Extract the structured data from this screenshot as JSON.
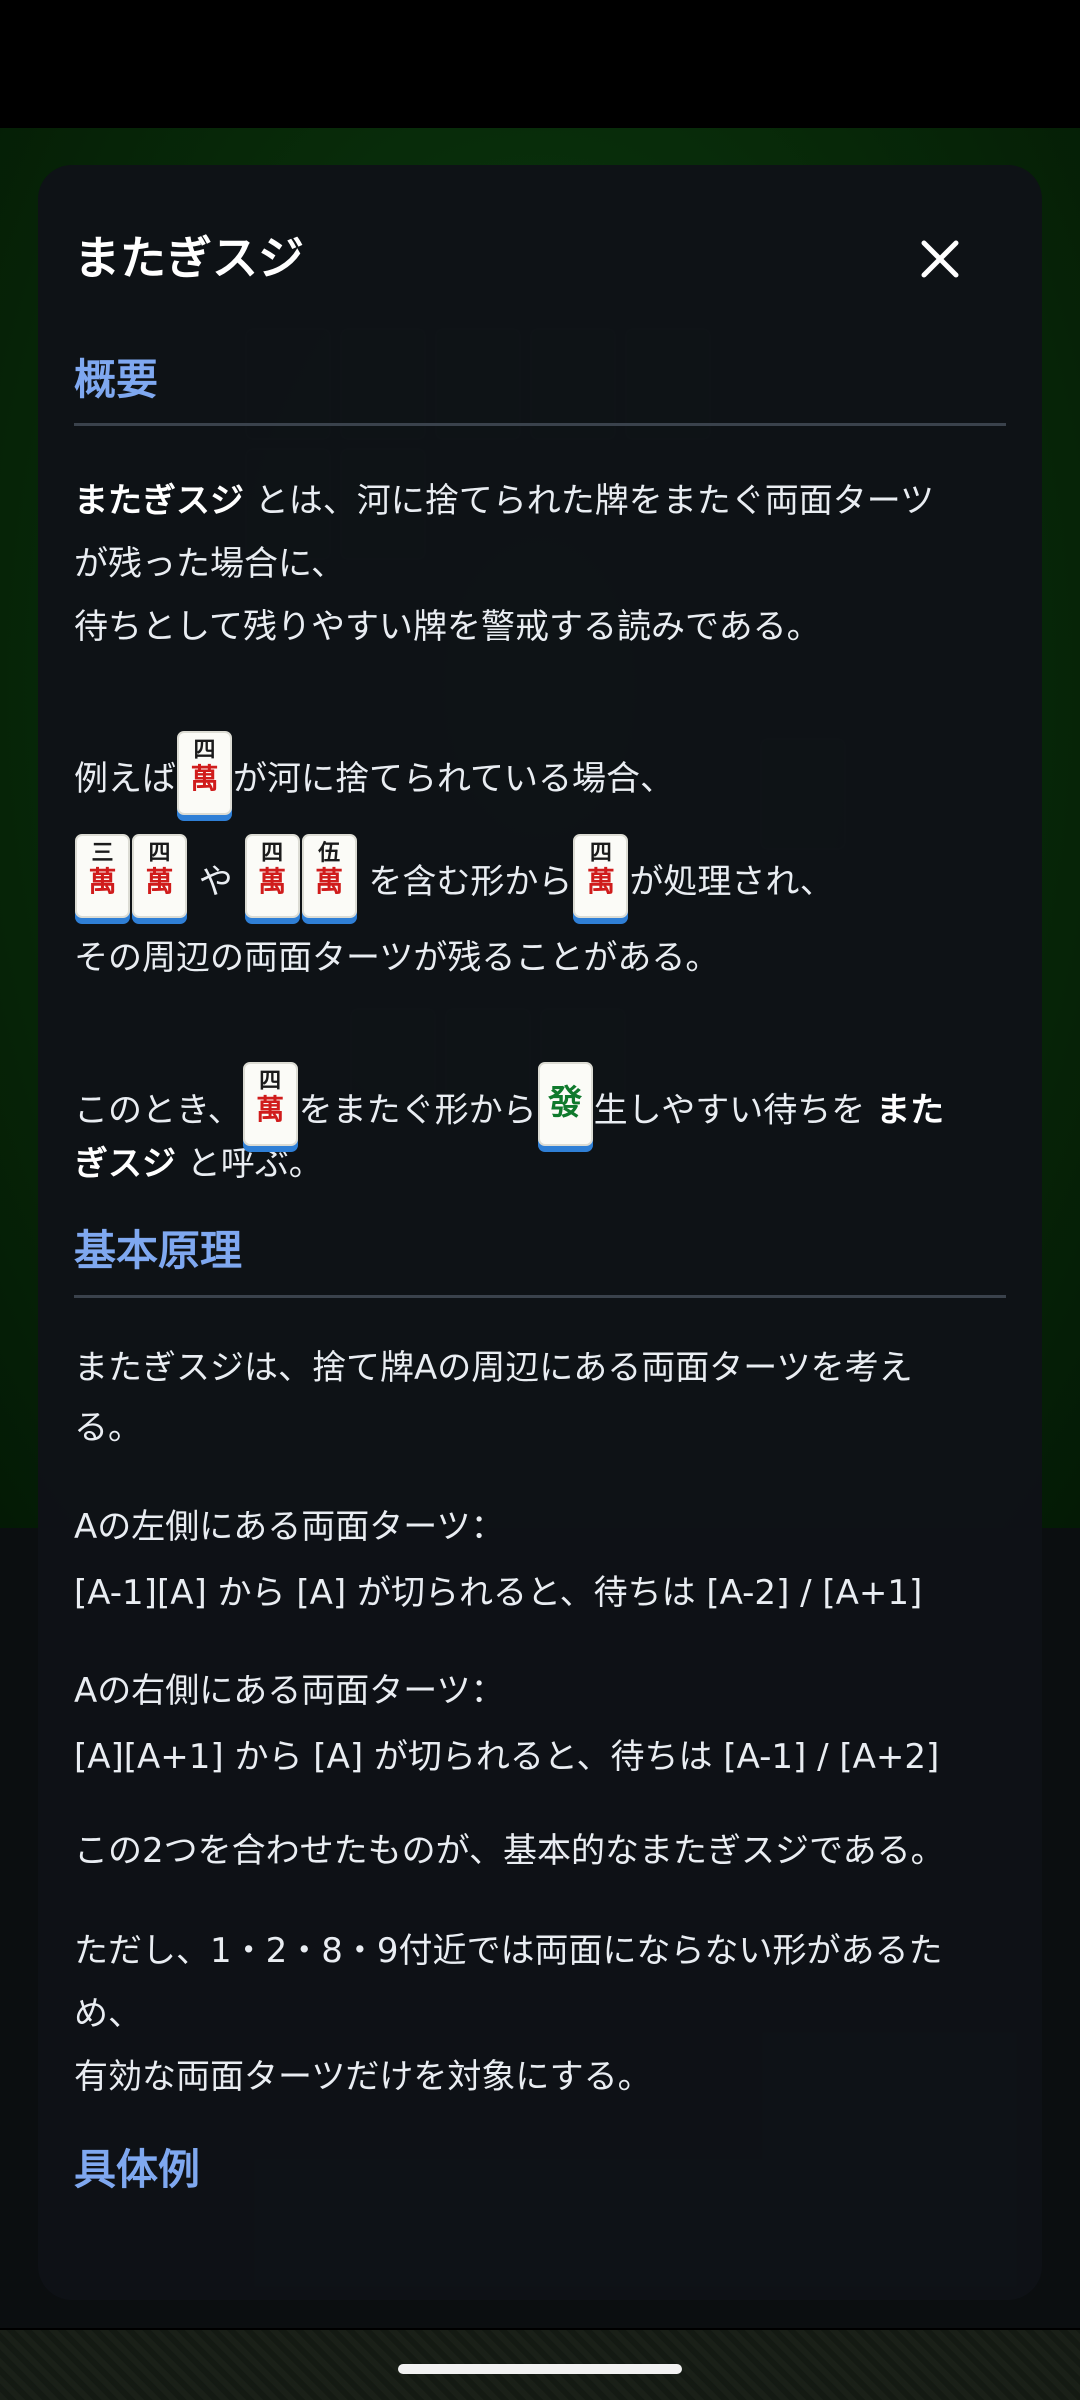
{
  "modal": {
    "title": "またぎスジ",
    "close_icon": "close-icon"
  },
  "sections": {
    "overview": {
      "title": "概要",
      "p1_bold": "またぎスジ",
      "p1_line1_rest": " とは、河に捨てられた牌をまたぐ両面ターツ",
      "p1_line2": "が残った場合に、",
      "p1_line3": "待ちとして残りやすい牌を警戒する読みである。",
      "ex_prefix": "例えば",
      "ex_suffix": "が河に捨てられている場合、",
      "ex_line2_mid": " や ",
      "ex_line2_mid2": " を含む形から",
      "ex_line2_end": "が処理され、",
      "ex_line3": "その周辺の両面ターツが残ることがある。",
      "then_prefix": "このとき、",
      "then_mid": "をまたぐ形から",
      "then_end": "生しやすい待ちを ",
      "then_bold1": "また",
      "then_bold2": "ぎスジ",
      "then_tail": " と呼ぶ。"
    },
    "principle": {
      "title": "基本原理",
      "p1_line1": "またぎスジは、捨て牌Aの周辺にある両面ターツを考え",
      "p1_line2": "る。",
      "left_label": "Aの左側にある両面ターツ：",
      "left_desc": "[A-1][A] から [A] が切られると、待ちは [A-2] / [A+1]",
      "right_label": "Aの右側にある両面ターツ：",
      "right_desc": "[A][A+1] から [A] が切られると、待ちは [A-1] / [A+2]",
      "combined": "この2つを合わせたものが、基本的なまたぎスジである。",
      "note_line1": "ただし、1・2・8・9付近では両面にならない形があるた",
      "note_line2": "め、",
      "note_line3": "有効な両面ターツだけを対象にする。"
    },
    "examples": {
      "title": "具体例"
    }
  },
  "tiles": {
    "t4m": {
      "num": "四",
      "suit": "萬"
    },
    "t3m": {
      "num": "三",
      "suit": "萬"
    },
    "t5m": {
      "num": "伍",
      "suit": "萬"
    },
    "hatsu": {
      "num": "發"
    }
  },
  "colors": {
    "accent": "#7fa8f0",
    "modal_bg": "#0e1217",
    "tile_red": "#d01c1c",
    "tile_green": "#0f7a2d",
    "tile_underline": "#2f7fd6"
  }
}
